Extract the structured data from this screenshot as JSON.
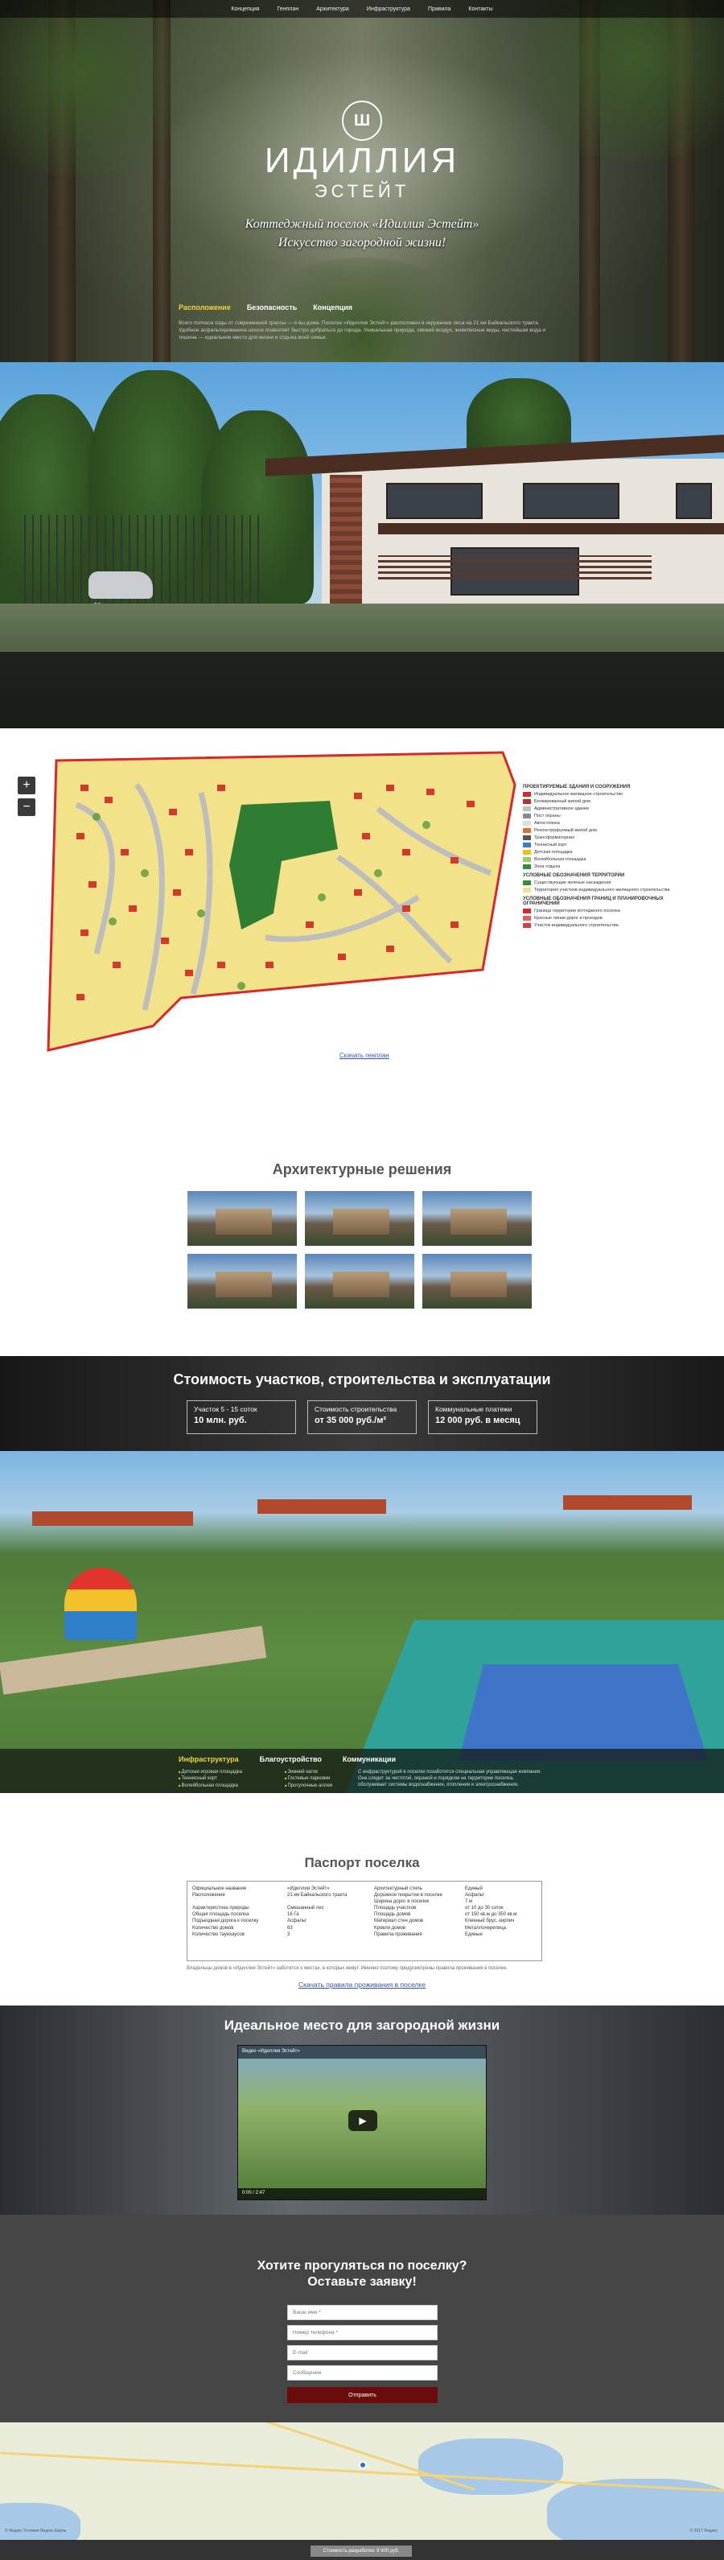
{
  "nav": [
    "Концепция",
    "Генплан",
    "Архитектура",
    "Инфраструктура",
    "Правила",
    "Контакты"
  ],
  "hero": {
    "logo_mark": "Ш",
    "logo_word": "ИДИЛЛИЯ",
    "logo_sub": "ЭСТЕЙТ",
    "tagline1": "Коттеджный поселок «Идиллия Эстейт»",
    "tagline2": "Искусство загородной жизни!"
  },
  "location": {
    "tabs": [
      "Расположение",
      "Безопасность",
      "Концепция"
    ],
    "active_tab": 0,
    "text": "Всего полчаса езды от современной трассы — и вы дома. Поселок «Идиллия Эстейт» расположен в окружении леса на 21 км Байкальского тракта. Удобное асфальтированное шоссе позволяет быстро добраться до города. Уникальная природа, свежий воздух, живописные виды, чистейшая вода и тишина — идеальное место для жизни и отдыха всей семьи."
  },
  "plan": {
    "zoom_in": "+",
    "zoom_out": "−",
    "legend_title1": "ПРОЕКТИРУЕМЫЕ ЗДАНИЯ И СООРУЖЕНИЯ",
    "legend_items1": [
      {
        "label": "Индивидуальное жилищное строительство",
        "color": "#d9282c"
      },
      {
        "label": "Блокированный жилой дом",
        "color": "#b53030"
      },
      {
        "label": "Административное здание",
        "color": "#c0c0c0"
      },
      {
        "label": "Пост охраны",
        "color": "#8a8a8a"
      },
      {
        "label": "Автостоянка",
        "color": "#dddddd"
      },
      {
        "label": "Реконструируемый жилой дом",
        "color": "#e07030"
      },
      {
        "label": "Трансформаторная",
        "color": "#555555"
      },
      {
        "label": "Теннисный корт",
        "color": "#3a7ad0"
      },
      {
        "label": "Детская площадка",
        "color": "#f0c020"
      },
      {
        "label": "Волейбольная площадка",
        "color": "#9acb6a"
      },
      {
        "label": "Зона отдыха",
        "color": "#2f8f3a"
      }
    ],
    "legend_title2": "УСЛОВНЫЕ ОБОЗНАЧЕНИЯ ТЕРРИТОРИИ",
    "legend_items2": [
      {
        "label": "Существующие зеленые насаждения",
        "color": "#3a8a3a"
      },
      {
        "label": "Территория участков индивидуального жилищного строительства",
        "color": "#f3e08a"
      }
    ],
    "legend_title3": "УСЛОВНЫЕ ОБОЗНАЧЕНИЯ ГРАНИЦ И ПЛАНИРОВОЧНЫХ ОГРАНИЧЕНИЙ",
    "legend_items3": [
      {
        "label": "Граница территории коттеджного поселка",
        "color": "#d9282c"
      },
      {
        "label": "Красные линии дорог и проездов",
        "color": "#e06060"
      },
      {
        "label": "Участок индивидуального строительства",
        "color": "#cc4444"
      }
    ],
    "link": "Скачать генплан"
  },
  "architecture": {
    "title": "Архитектурные решения",
    "photos": [
      "house-photo-1",
      "house-photo-2",
      "house-photo-3",
      "house-photo-4",
      "house-photo-5",
      "house-photo-6"
    ]
  },
  "prices": {
    "title": "Стоимость участков, строительства и эксплуатации",
    "boxes": [
      {
        "label": "Участок 5 - 15 соток",
        "value": "10 млн. руб."
      },
      {
        "label": "Стоимость строительства",
        "value": "от 35 000 руб./м²"
      },
      {
        "label": "Коммунальные платежи",
        "value": "12 000 руб. в месяц"
      }
    ]
  },
  "infrastructure": {
    "tabs": [
      "Инфраструктура",
      "Благоустройство",
      "Коммуникации"
    ],
    "active_tab": 0,
    "list1": [
      "Детская игровая площадка",
      "Теннисный корт",
      "Волейбольная площадка"
    ],
    "list2": [
      "Зимний каток",
      "Гостевые парковки",
      "Прогулочные аллеи"
    ],
    "text": "С инфраструктурой в поселке позаботится специальная управляющая компания. Она следит за чистотой, охраной и порядком на территории поселка, обслуживает системы водоснабжения, отопления и электроснабжения."
  },
  "passport": {
    "title": "Паспорт поселка",
    "col1": [
      "Официальное название",
      "Расположение",
      "",
      "Характеристика природы",
      "Общая площадь поселка",
      "Подъездная дорога к поселку",
      "Количество домов",
      "Количество таунхаусов"
    ],
    "col2": [
      "«Идиллия Эстейт»",
      "21 км Байкальского тракта",
      "",
      "Смешанный лес",
      "16 Га",
      "Асфальт",
      "63",
      "3"
    ],
    "col3": [
      "Архитектурный стиль",
      "Дорожное покрытие в поселке",
      "Ширина дорог в поселке",
      "Площадь участков",
      "Площадь домов",
      "Материал стен домов",
      "Кровля домов",
      "Правила проживания"
    ],
    "col4": [
      "Единый",
      "Асфальт",
      "7 м",
      "от 10 до 30 соток",
      "от 150 кв.м до 350 кв.м",
      "Клееный брус, кирпич",
      "Металлочерепица",
      "Единые"
    ],
    "note": "Владельцы домов в «Идиллия Эстейт» заботятся о местах, в которых живут. Именно поэтому предусмотрены правила проживания в поселке.",
    "link": "Скачать правила проживания в поселке"
  },
  "video": {
    "title": "Идеальное место для загородной жизни",
    "bar_title": "Видео «Идиллия Эстейт»",
    "time": "0:00 / 2:47",
    "play_icon": "▶"
  },
  "form": {
    "title1": "Хотите прогуляться по поселку?",
    "title2": "Оставьте заявку!",
    "fields": [
      "Ваше имя *",
      "Номер телефона *",
      "E-mail",
      "Сообщение"
    ],
    "submit": "Отправить"
  },
  "map": {
    "copyright": "© Яндекс  Условия  Яндекс.Карты",
    "copyright_right": "© 2017 Яндекс"
  },
  "footer": {
    "button": "Стоимость разработки: 9 900 руб."
  }
}
